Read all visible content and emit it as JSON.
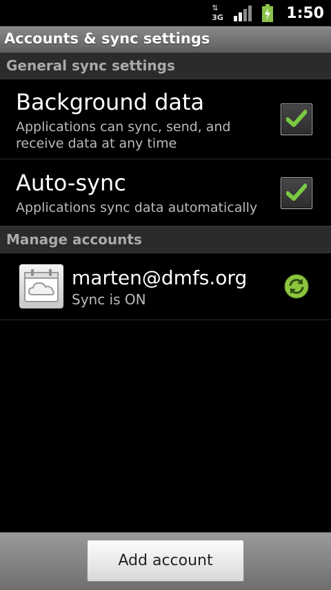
{
  "status_bar": {
    "network_label": "3G",
    "time": "1:50",
    "icons": [
      "network-3g-icon",
      "signal-icon",
      "battery-charging-icon"
    ],
    "battery_color": "#8bc34a"
  },
  "title_bar": {
    "title": "Accounts & sync settings"
  },
  "sections": {
    "general": "General sync settings",
    "manage": "Manage accounts"
  },
  "preferences": [
    {
      "title": "Background data",
      "summary_line1": "Applications can sync, send, and",
      "summary_line2": "receive data at any time",
      "checked": true
    },
    {
      "title": "Auto-sync",
      "summary_line1": "Applications sync data automatically",
      "checked": true
    }
  ],
  "account": {
    "name": "marten@dmfs.org",
    "status": "Sync is ON",
    "icon": "calendar-cloud-icon",
    "sync_icon": "sync-on-icon"
  },
  "bottom_bar": {
    "add_label": "Add account"
  },
  "colors": {
    "check": "#7ac943",
    "sync_green": "#8cc63f"
  }
}
